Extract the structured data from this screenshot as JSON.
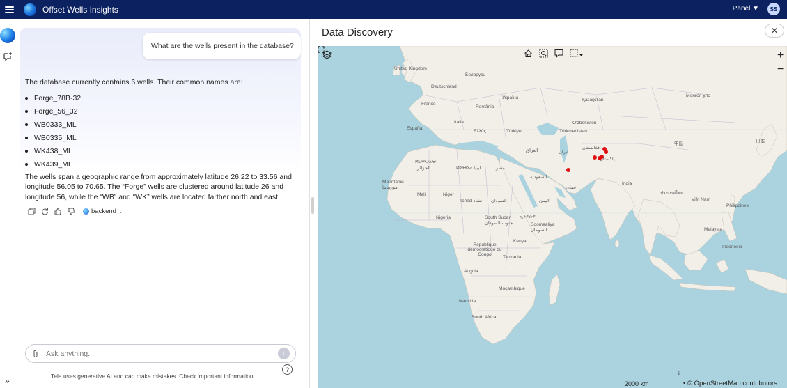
{
  "app": {
    "title": "Offset Wells Insights",
    "panel_menu": "Panel ▼",
    "user_initials": "SS"
  },
  "chat": {
    "user_question": "What are the wells present in the database?",
    "answer_intro": "The database currently contains 6 wells. Their common names are:",
    "wells": [
      "Forge_78B-32",
      "Forge_56_32",
      "WB0333_ML",
      "WB0335_ML",
      "WK438_ML",
      "WK439_ML"
    ],
    "answer_summary": "The wells span a geographic range from approximately latitude 26.22 to 33.56 and longitude 56.05 to 70.65. The “Forge” wells are clustered around latitude 26 and longitude 56, while the “WB” and “WK” wells are located farther north and east.",
    "backend_label": "backend",
    "input_placeholder": "Ask anything...",
    "disclaimer": "Tela uses generative AI and can make mistakes. Check important information.",
    "help_label": "?"
  },
  "data_discovery": {
    "title": "Data Discovery",
    "close_label": "✕",
    "scale": "2000 km",
    "info": "i",
    "attribution": "© OpenStreetMap contributors",
    "map_labels": [
      "United Kingdom",
      "Беларусь",
      "Deutschland",
      "Україна",
      "France",
      "România",
      "Қазақстан",
      "Монгол улс",
      "Italia",
      "España",
      "Ελλάς",
      "Türkiye",
      "O‘zbekiston",
      "Türkmenistan",
      "中国",
      "日本",
      "العراق",
      "ایران",
      "افغانستان",
      "پاکستان",
      "ⵍⵎⵖⵔⵉⴱ",
      "الجزائر",
      "ⵍⵉⴱⵢⴰ ليبيا",
      "مصر",
      "السعودية",
      "عمان",
      "India",
      "ประเทศไทย",
      "Việt Nam",
      "Mauritanie موريتانيا",
      "Mali",
      "Niger",
      "Tchad تشاد",
      "السودان",
      "اليمن",
      "Philippines",
      "Nigeria",
      "South Sudan جنوب السودان",
      "ኢትዮጵያ",
      "Soomaaliya الصومال",
      "Malaysia",
      "Indonesia",
      "République démocratique du Congo",
      "Kenya",
      "Tanzania",
      "Angola",
      "Moçambique",
      "Namibia",
      "South Africa"
    ]
  }
}
